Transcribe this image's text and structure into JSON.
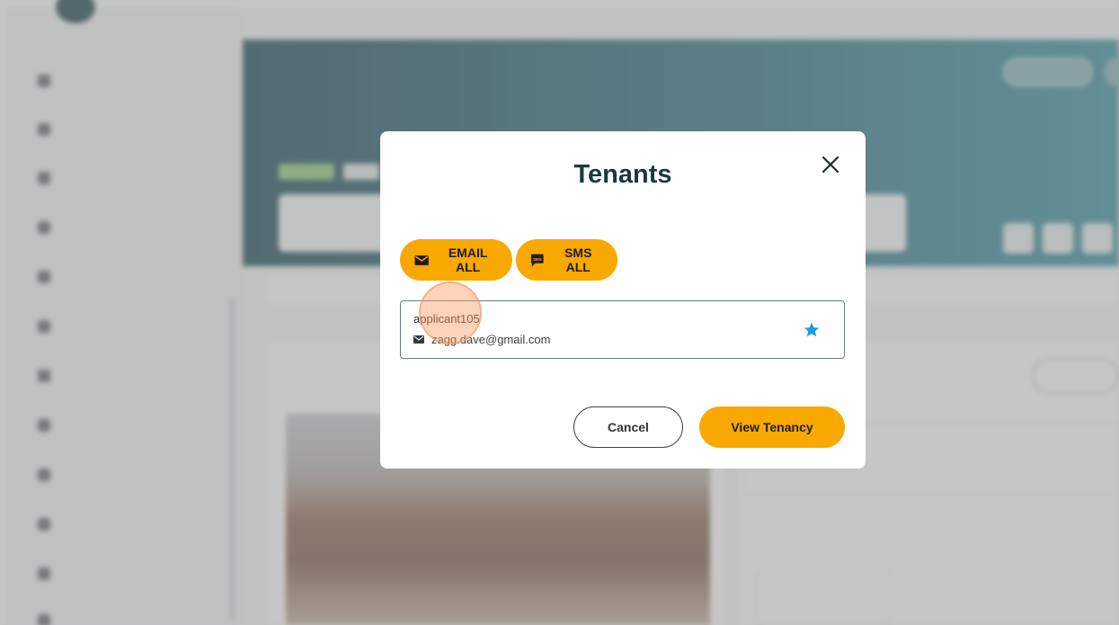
{
  "modal": {
    "title": "Tenants",
    "email_all_label": "EMAIL ALL",
    "sms_all_label": "SMS ALL",
    "sms_icon_text": "SMS",
    "tenant": {
      "name": "applicant105",
      "email": "zagg.dave@gmail.com",
      "starred": true
    },
    "cancel_label": "Cancel",
    "view_tenancy_label": "View Tenancy"
  },
  "colors": {
    "accent": "#f9a800",
    "title": "#183a3e",
    "star": "#1a9be0",
    "header_teal": "#3a7584"
  },
  "icons": {
    "email_all": "envelope-icon",
    "sms_all": "sms-bubble-icon",
    "close": "close-icon",
    "tenant_email": "envelope-icon",
    "favourite": "star-icon"
  }
}
